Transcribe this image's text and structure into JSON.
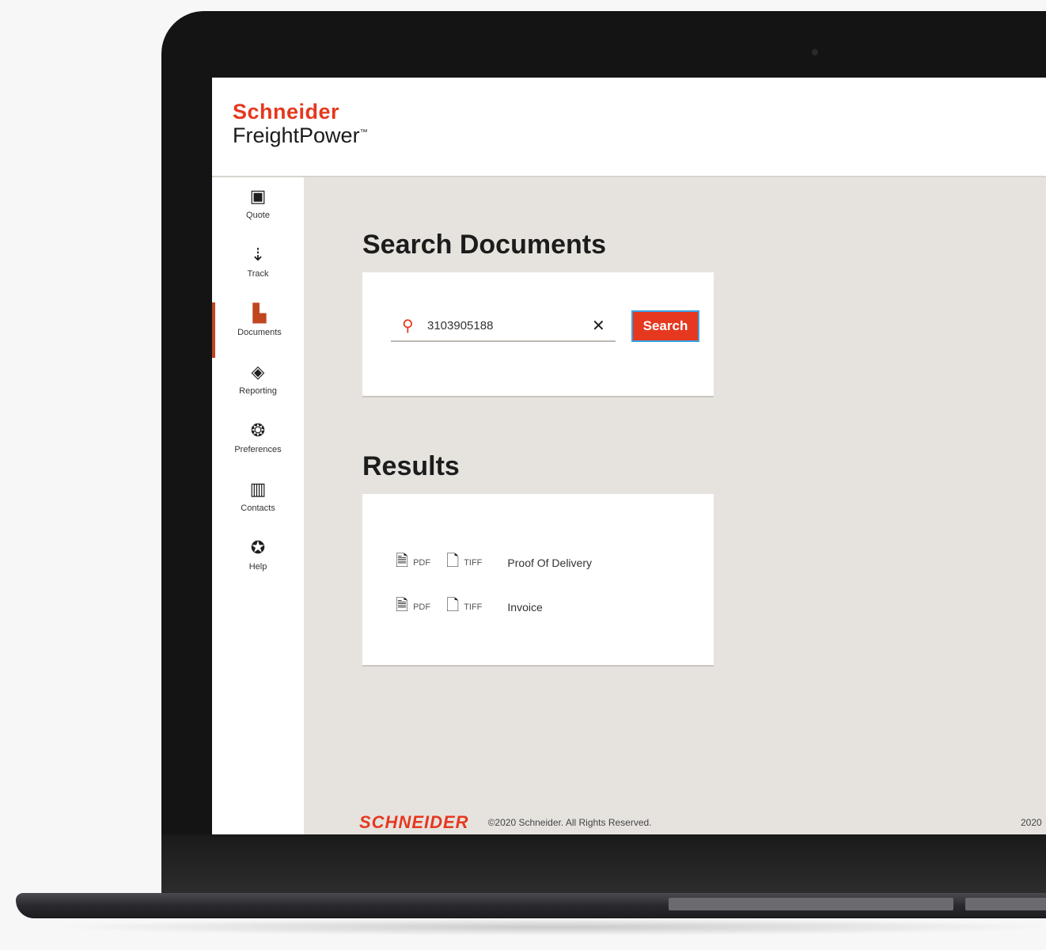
{
  "brand": {
    "top": "Schneider",
    "bottom": "FreightPower",
    "tm": "™"
  },
  "sidebar": {
    "items": [
      {
        "label": "Quote",
        "icon": "quote-icon",
        "glyph": "▣"
      },
      {
        "label": "Track",
        "icon": "track-icon",
        "glyph": "⇣"
      },
      {
        "label": "Documents",
        "icon": "documents-icon",
        "glyph": "▙"
      },
      {
        "label": "Reporting",
        "icon": "reporting-icon",
        "glyph": "◈"
      },
      {
        "label": "Preferences",
        "icon": "preferences-icon",
        "glyph": "❂"
      },
      {
        "label": "Contacts",
        "icon": "contacts-icon",
        "glyph": "▥"
      },
      {
        "label": "Help",
        "icon": "help-icon",
        "glyph": "✪"
      }
    ],
    "active": "Documents"
  },
  "search": {
    "title": "Search Documents",
    "value": "3103905188",
    "button_label": "Search",
    "clear_glyph": "✕",
    "search_glyph": "⚲"
  },
  "results": {
    "title": "Results",
    "rows": [
      {
        "ext1": "PDF",
        "ext2": "TIFF",
        "name": "Proof Of Delivery"
      },
      {
        "ext1": "PDF",
        "ext2": "TIFF",
        "name": "Invoice"
      }
    ]
  },
  "footer": {
    "logo": "SCHNEIDER",
    "copyright": "©2020 Schneider. All Rights Reserved.",
    "right": "2020"
  },
  "colors": {
    "brand_red": "#e5381f",
    "active_accent": "#c0461f",
    "focus_blue": "#3aa3e6"
  }
}
